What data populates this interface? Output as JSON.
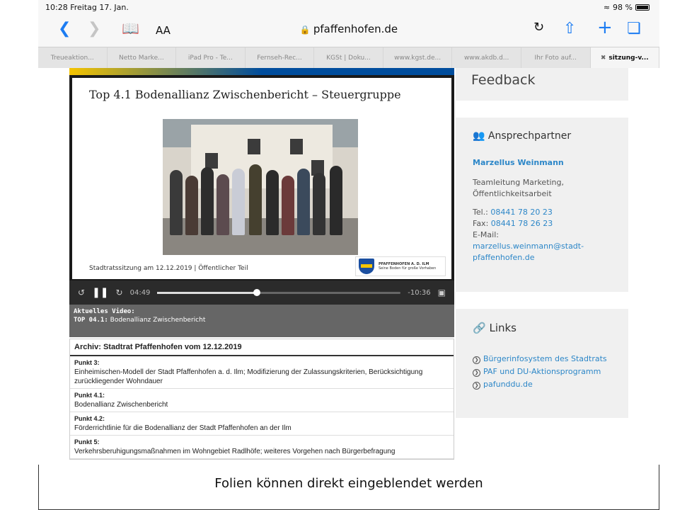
{
  "status": {
    "time": "10:28",
    "date": "Freitag 17. Jan.",
    "battery": "98 %"
  },
  "browser": {
    "aa_label": "AA",
    "url": "pfaffenhofen.de",
    "tabs": [
      "Treueaktion...",
      "Netto Marke...",
      "iPad Pro - Te...",
      "Fernseh-Rec...",
      "KGSt | Doku...",
      "www.kgst.de...",
      "www.akdb.d...",
      "Ihr Foto auf...",
      "sitzung-v..."
    ]
  },
  "video": {
    "slide_title": "Top 4.1 Bodenallianz Zwischenbericht – Steuergruppe",
    "slide_footer": "Stadtratssitzung am 12.12.2019 | Öffentlicher Teil",
    "logo_text": "PFAFFENHOFEN A. D. ILM",
    "logo_sub": "Seine Boden für große Vorhaben",
    "elapsed": "04:49",
    "remaining": "-10:36",
    "progress": 0.41
  },
  "current_video": {
    "label": "Aktuelles Video:",
    "top_code": "TOP 04.1:",
    "top_title": "Bodenallianz Zwischenbericht"
  },
  "archive": {
    "title": "Archiv: Stadtrat Pfaffenhofen vom 12.12.2019",
    "items": [
      {
        "key": "Punkt 3:",
        "text": "Einheimischen-Modell der Stadt Pfaffenhofen a. d. Ilm; Modifizierung der Zulassungskriterien, Berücksichtigung zurückliegender Wohndauer"
      },
      {
        "key": "Punkt 4.1:",
        "text": "Bodenallianz Zwischenbericht"
      },
      {
        "key": "Punkt 4.2:",
        "text": "Förderrichtlinie für die Bodenallianz der Stadt Pfaffenhofen an der Ilm"
      },
      {
        "key": "Punkt 5:",
        "text": "Verkehrsberuhigungsmaßnahmen im Wohngebiet Radlhöfe; weiteres Vorgehen nach Bürgerbefragung"
      }
    ]
  },
  "sidebar": {
    "feedback": "Feedback",
    "contact_heading": "Ansprechpartner",
    "contact_name": "Marzellus Weinmann",
    "contact_role": "Teamleitung Marketing, Öffentlichkeitsarbeit",
    "tel_label": "Tel.:",
    "tel": "08441 78 20 23",
    "fax_label": "Fax:",
    "fax": "08441 78 26 23",
    "email_label": "E-Mail:",
    "email": "marzellus.weinmann@stadt-pfaffenhofen.de",
    "links_heading": "Links",
    "links": [
      "Bürgerinfosystem des Stadtrats",
      "PAF und DU-Aktionsprogramm",
      "pafunddu.de"
    ]
  },
  "caption": "Folien können direkt eingeblendet werden",
  "colors": {
    "accent": "#1c7cf2",
    "link": "#2d87c8",
    "sidebar_bg": "#f0f0f0"
  }
}
